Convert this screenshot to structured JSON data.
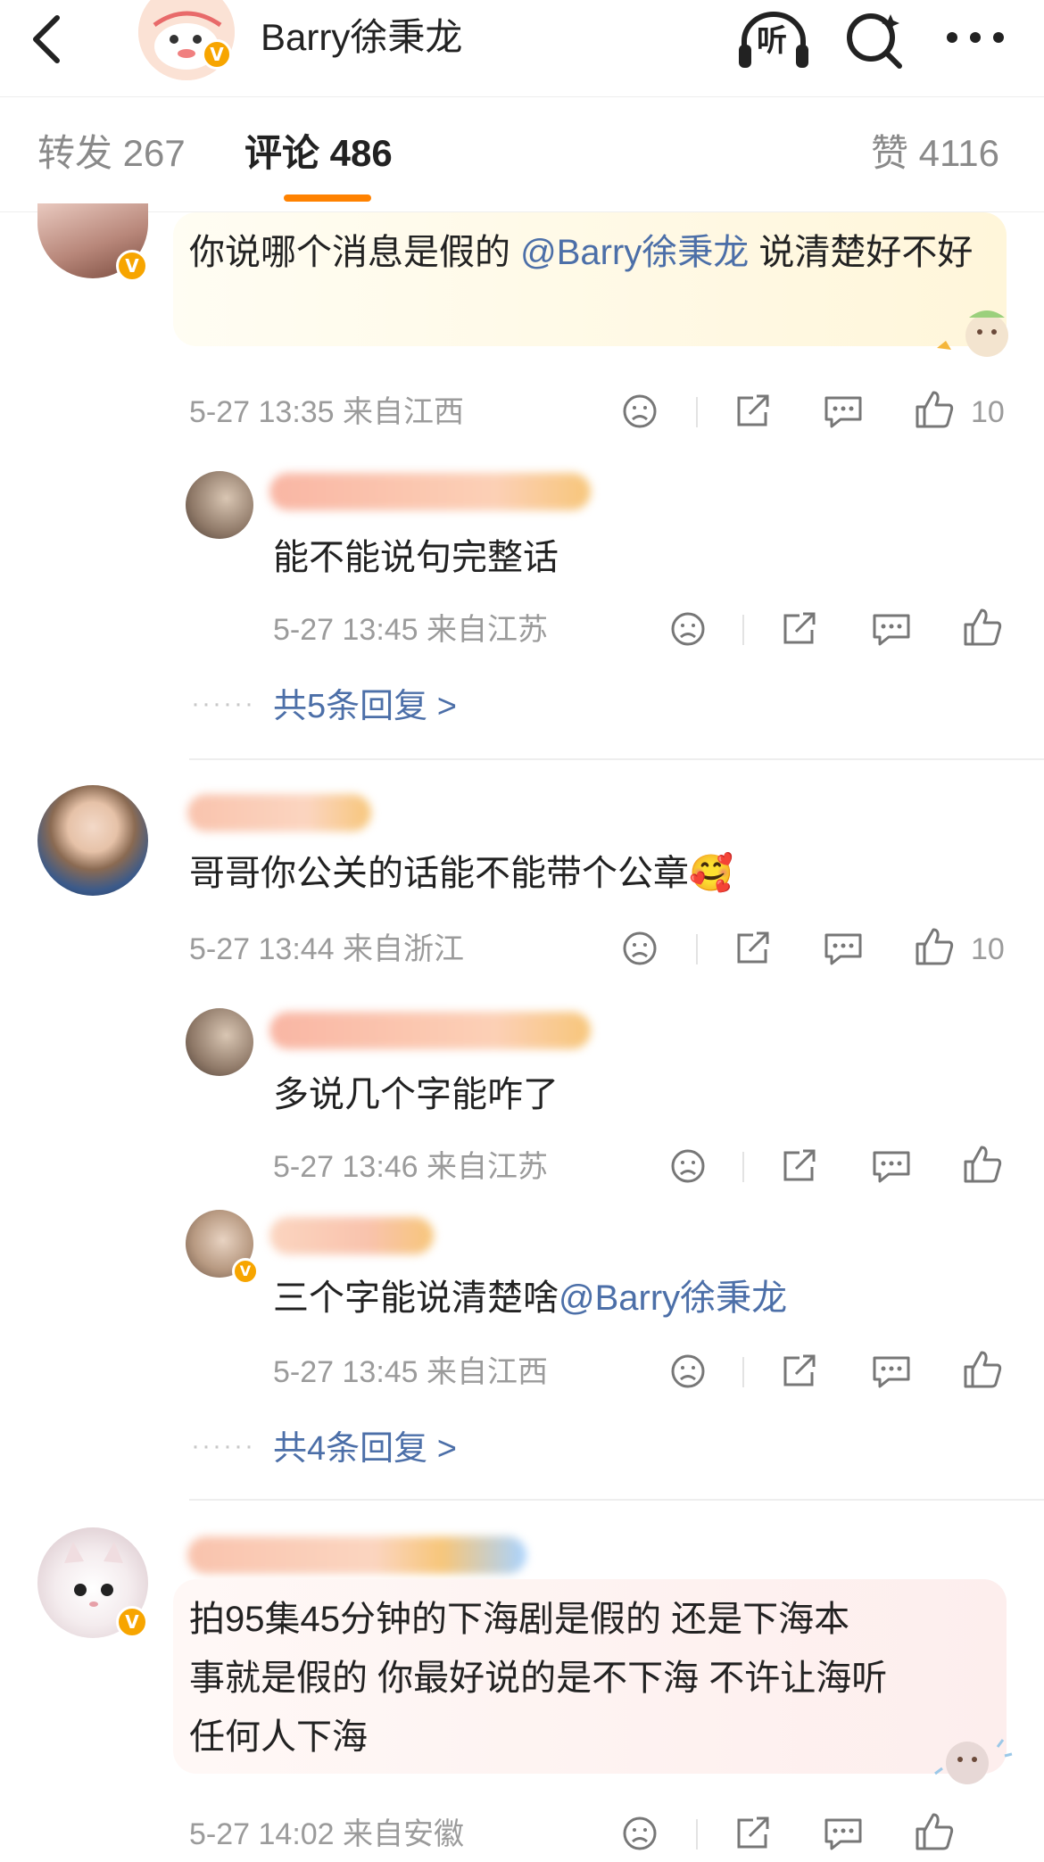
{
  "header": {
    "title": "Barry徐秉龙",
    "listen_label": "听"
  },
  "tabs": [
    {
      "label": "转发 267"
    },
    {
      "label": "评论 486"
    },
    {
      "label": "赞 4116"
    }
  ],
  "comments": [
    {
      "text_pre": "你说哪个消息是假的 ",
      "mention": "@Barry徐秉龙",
      "text_post": " 说清楚好不好",
      "meta": "5-27 13:35 来自江西",
      "likes": "10",
      "replies": [
        {
          "text": "能不能说句完整话",
          "meta": "5-27 13:45 来自江苏"
        }
      ],
      "more_replies": "共5条回复 >"
    },
    {
      "text": "哥哥你公关的话能不能带个公章",
      "emoji": "🥰",
      "meta": "5-27 13:44 来自浙江",
      "likes": "10",
      "replies": [
        {
          "text": "多说几个字能咋了",
          "meta": "5-27 13:46 来自江苏"
        },
        {
          "text_pre": "三个字能说清楚啥",
          "mention": "@Barry徐秉龙",
          "meta": "5-27 13:45 来自江西"
        }
      ],
      "more_replies": "共4条回复 >"
    },
    {
      "line1": "拍95集45分钟的下海剧是假的 还是下海本",
      "line2": "事就是假的 你最好说的是不下海 不许让海听",
      "line3": "任何人下海",
      "meta": "5-27 14:02 来自安徽"
    }
  ],
  "badge_letter": "V",
  "ellipsis": "······",
  "colors": {
    "accent": "#ff8200",
    "link": "#4c6fa8",
    "meta": "#9b9b9b",
    "badge": "#f7a500"
  }
}
